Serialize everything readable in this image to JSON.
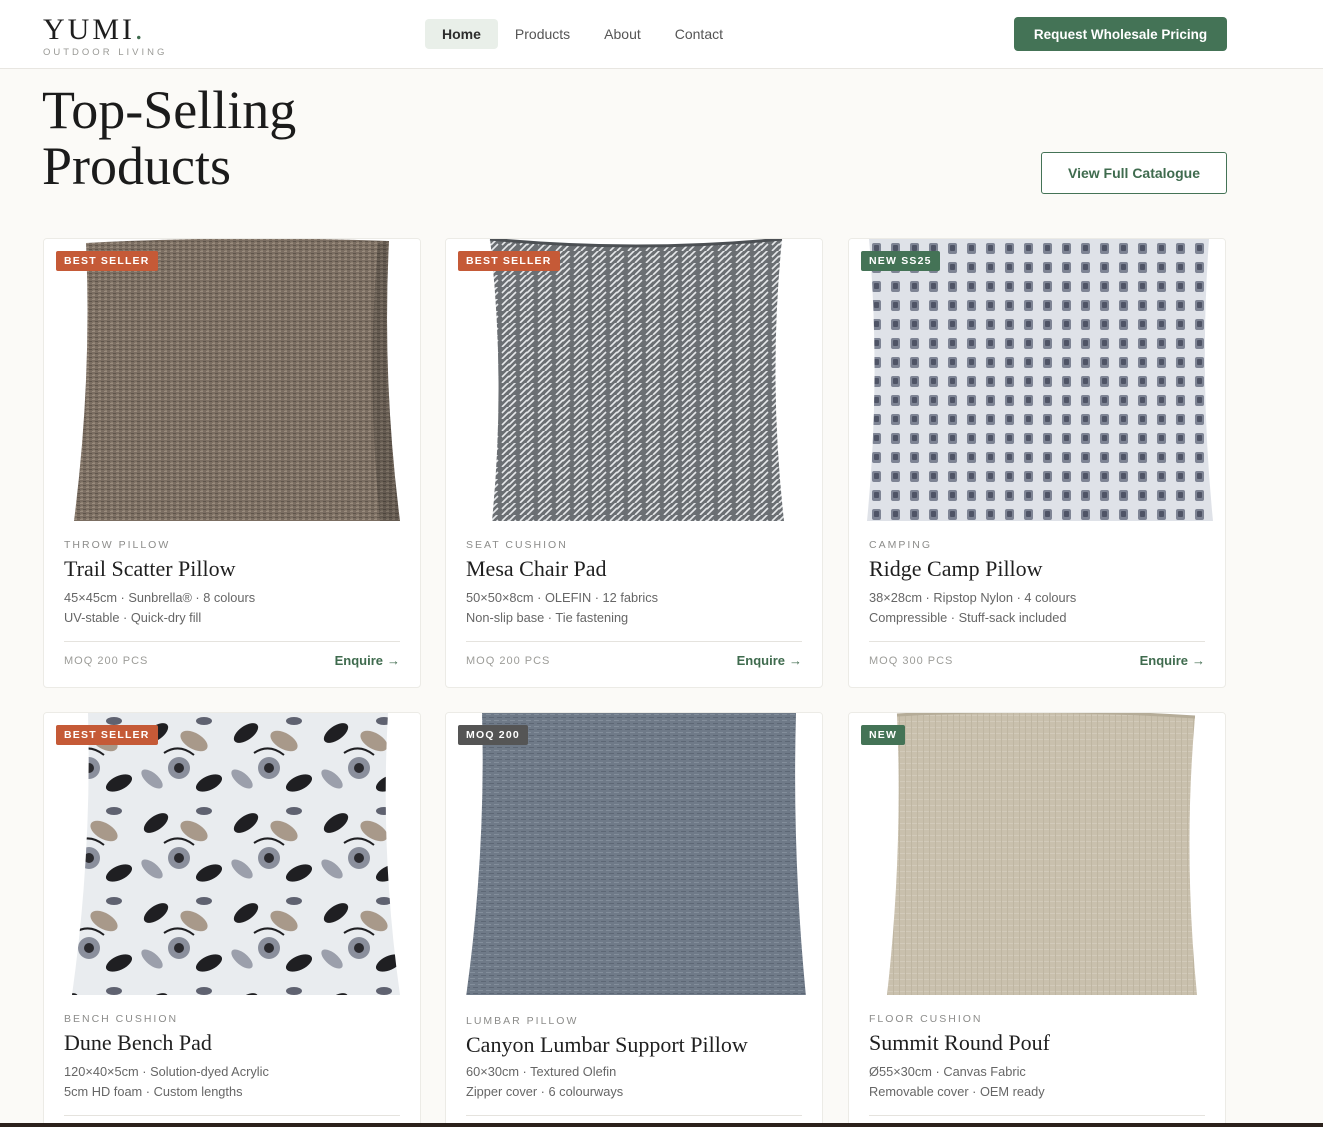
{
  "header": {
    "logo_name": "YUMI",
    "logo_dot": ".",
    "logo_tagline": "OUTDOOR LIVING",
    "nav": [
      "Home",
      "Products",
      "About",
      "Contact"
    ],
    "active_nav": "Home",
    "cta_label": "Request Wholesale Pricing"
  },
  "section": {
    "title_line1": "Top-Selling",
    "title_line2": "Products",
    "catalogue_button": "View Full Catalogue"
  },
  "colors": {
    "accent_green": "#447356",
    "badge_orange": "#c55a37",
    "badge_dark": "#555555",
    "page_background": "#fbfaf7"
  },
  "products": [
    {
      "badge": "BEST SELLER",
      "category": "THROW PILLOW",
      "name": "Trail Scatter Pillow",
      "spec1": "45×45cm · Sunbrella® · 8 colours",
      "spec2": "UV-stable · Quick-dry fill",
      "moq": "MOQ 200 PCS",
      "enquire": "Enquire"
    },
    {
      "badge": "BEST SELLER",
      "category": "SEAT CUSHION",
      "name": "Mesa Chair Pad",
      "spec1": "50×50×8cm · OLEFIN · 12 fabrics",
      "spec2": "Non-slip base · Tie fastening",
      "moq": "MOQ 200 PCS",
      "enquire": "Enquire"
    },
    {
      "badge": "NEW SS25",
      "category": "CAMPING",
      "name": "Ridge Camp Pillow",
      "spec1": "38×28cm · Ripstop Nylon · 4 colours",
      "spec2": "Compressible · Stuff-sack included",
      "moq": "MOQ 300 PCS",
      "enquire": "Enquire"
    },
    {
      "badge": "BEST SELLER",
      "category": "BENCH CUSHION",
      "name": "Dune Bench Pad",
      "spec1": "120×40×5cm · Solution-dyed Acrylic",
      "spec2": "5cm HD foam · Custom lengths"
    },
    {
      "badge": "MOQ 200",
      "category": "LUMBAR PILLOW",
      "name": "Canyon Lumbar Support Pillow",
      "spec1": "60×30cm · Textured Olefin",
      "spec2": "Zipper cover · 6 colourways"
    },
    {
      "badge": "NEW",
      "category": "FLOOR CUSHION",
      "name": "Summit Round Pouf",
      "spec1": "Ø55×30cm · Canvas Fabric",
      "spec2": "Removable cover · OEM ready"
    }
  ]
}
